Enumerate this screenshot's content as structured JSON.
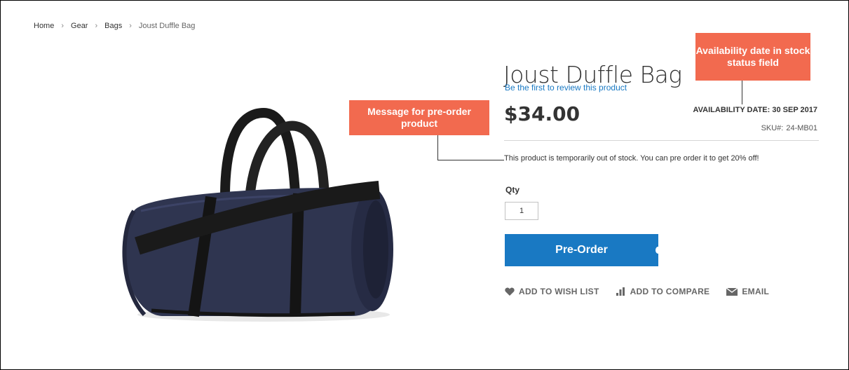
{
  "breadcrumb": {
    "items": [
      {
        "label": "Home"
      },
      {
        "label": "Gear"
      },
      {
        "label": "Bags"
      },
      {
        "label": "Joust Duffle Bag"
      }
    ],
    "separator": ">"
  },
  "product": {
    "title": "Joust Duffle Bag",
    "review_link": "Be the first to review this product",
    "price": "$34.00",
    "availability": "AVAILABILITY DATE: 30 SEP 2017",
    "sku_label": "SKU#:",
    "sku_value": "24-MB01",
    "preorder_message": "This product is temporarily out of stock. You can pre order it to get 20% off!",
    "qty_label": "Qty",
    "qty_value": "1",
    "preorder_button": "Pre-Order",
    "bag_color": "#2f3550"
  },
  "actions": [
    {
      "label": "ADD TO WISH LIST",
      "icon": "heart-icon"
    },
    {
      "label": "ADD TO COMPARE",
      "icon": "compare-chart-icon"
    },
    {
      "label": "EMAIL",
      "icon": "envelope-icon"
    }
  ],
  "annotations": {
    "preorder_message": "Message for pre-order product",
    "availability_date": "Availability date in stock status field",
    "color": "#f26a4f"
  },
  "colors": {
    "accent": "#1979c3",
    "text": "#333333"
  }
}
